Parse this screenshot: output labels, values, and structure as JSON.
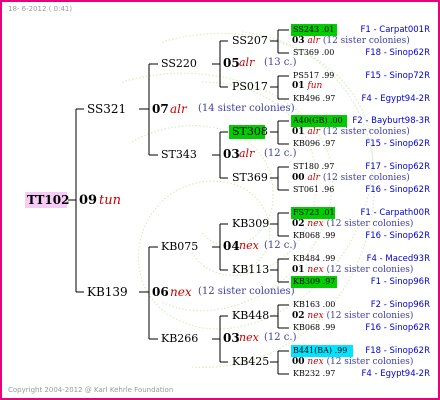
{
  "header": {
    "date": "18- 6-2012 ( 0:41)"
  },
  "footer": {
    "copyright": "Copyright 2004-2012 @ Karl Kehrle Foundation"
  },
  "colors": {
    "border": "#e6007e",
    "root_box": "#f5ccf5",
    "green_box": "#00cc00",
    "cyan_box": "#00e5ff",
    "blue_text": "#0000cc",
    "red_text": "#cc0000"
  },
  "root": {
    "id": "TT102",
    "gen": "09",
    "name": "tun"
  },
  "g1": {
    "ss321": {
      "id": "SS321",
      "gen": "07",
      "name": "alr",
      "sisters": "(14 sister colonies)"
    },
    "kb139": {
      "id": "KB139",
      "gen": "06",
      "name": "nex",
      "sisters": "(12 sister colonies)"
    }
  },
  "g2": {
    "ss220": {
      "id": "SS220",
      "gen": "05",
      "name": "alr",
      "sisters": "(13 c.)"
    },
    "st343": {
      "id": "ST343",
      "gen": "03",
      "name": "alr",
      "sisters": "(12 c.)"
    },
    "kb075": {
      "id": "KB075",
      "gen": "04",
      "name": "nex",
      "sisters": "(12 c.)"
    },
    "kb266": {
      "id": "KB266",
      "gen": "03",
      "name": "nex",
      "sisters": "(12 c.)"
    }
  },
  "g3": {
    "ss207": {
      "id": "SS207",
      "gen": "03",
      "name": "alr",
      "sisters": "(12 sister colonies)"
    },
    "ps017": {
      "id": "PS017",
      "gen": "01",
      "name": "fun",
      "sisters": ""
    },
    "st308": {
      "id": "ST308",
      "gen": "01",
      "name": "alr",
      "sisters": "(12 sister colonies)"
    },
    "st369": {
      "id": "ST369",
      "gen": "00",
      "name": "alr",
      "sisters": "(12 sister colonies)"
    },
    "kb309": {
      "id": "KB309",
      "gen": "02",
      "name": "nex",
      "sisters": "(12 sister colonies)"
    },
    "kb113": {
      "id": "KB113",
      "gen": "01",
      "name": "nex",
      "sisters": "(12 sister colonies)"
    },
    "kb448": {
      "id": "KB448",
      "gen": "02",
      "name": "nex",
      "sisters": "(12 sister colonies)"
    },
    "kb425": {
      "id": "KB425",
      "gen": "00",
      "name": "nex",
      "sisters": "(12 sister colonies)"
    }
  },
  "g4": [
    {
      "id": "SS243 .01",
      "label": "F1 - Carpat001R"
    },
    {
      "id": "ST369 .00",
      "label": "F18 - Sinop62R"
    },
    {
      "id": "PS517 .99",
      "label": "F15 - Sinop72R"
    },
    {
      "id": "KB496 .97",
      "label": "F4 - Egypt94-2R"
    },
    {
      "id": "A40(GB) .00",
      "label": "F2 - Bayburt98-3R"
    },
    {
      "id": "KB096 .97",
      "label": "F15 - Sinop62R"
    },
    {
      "id": "ST180 .97",
      "label": "F17 - Sinop62R"
    },
    {
      "id": "ST061 .96",
      "label": "F16 - Sinop62R"
    },
    {
      "id": "FS723 .01",
      "label": "F1 - Carpath00R"
    },
    {
      "id": "KB068 .99",
      "label": "F16 - Sinop62R"
    },
    {
      "id": "KB484 .99",
      "label": "F4 - Maced93R"
    },
    {
      "id": "KB309 .97",
      "label": "F1 - Sinop96R"
    },
    {
      "id": "KB163 .00",
      "label": "F2 - Sinop96R"
    },
    {
      "id": "KB068 .99",
      "label": "F16 - Sinop62R"
    },
    {
      "id": "B441(BA) .99",
      "label": "F18 - Sinop62R"
    },
    {
      "id": "KB232 .97",
      "label": "F4 - Egypt94-2R"
    }
  ]
}
